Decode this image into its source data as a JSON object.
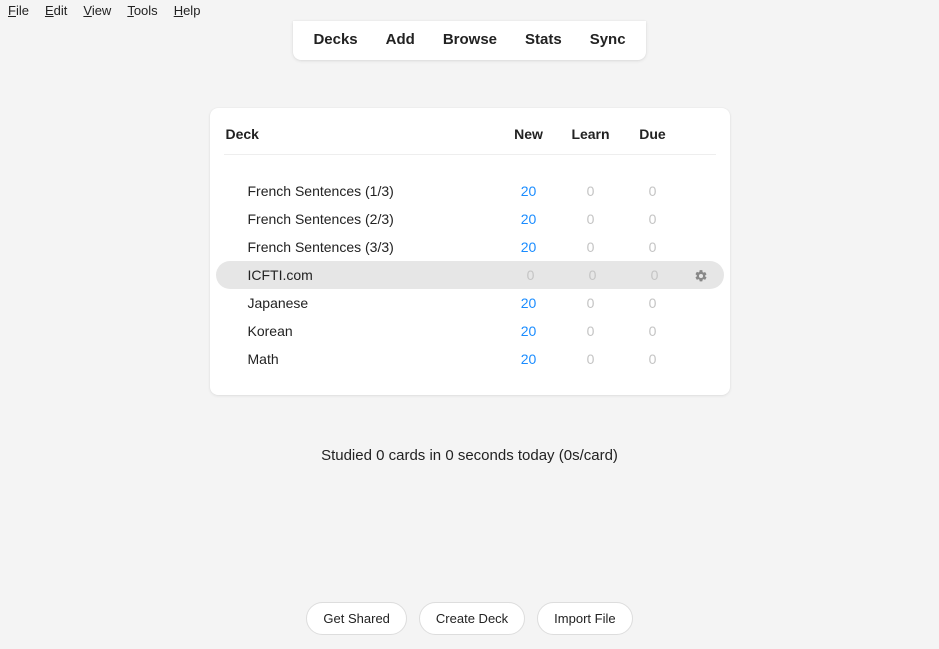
{
  "menubar": {
    "file": "File",
    "edit": "Edit",
    "view": "View",
    "tools": "Tools",
    "help": "Help"
  },
  "tabs": {
    "decks": "Decks",
    "add": "Add",
    "browse": "Browse",
    "stats": "Stats",
    "sync": "Sync"
  },
  "headers": {
    "deck": "Deck",
    "new": "New",
    "learn": "Learn",
    "due": "Due"
  },
  "decks": [
    {
      "name": "French Sentences (1/3)",
      "new": "20",
      "learn": "0",
      "due": "0",
      "hovered": false,
      "zero_new": false
    },
    {
      "name": "French Sentences (2/3)",
      "new": "20",
      "learn": "0",
      "due": "0",
      "hovered": false,
      "zero_new": false
    },
    {
      "name": "French Sentences (3/3)",
      "new": "20",
      "learn": "0",
      "due": "0",
      "hovered": false,
      "zero_new": false
    },
    {
      "name": "ICFTI.com",
      "new": "0",
      "learn": "0",
      "due": "0",
      "hovered": true,
      "zero_new": true
    },
    {
      "name": "Japanese",
      "new": "20",
      "learn": "0",
      "due": "0",
      "hovered": false,
      "zero_new": false
    },
    {
      "name": "Korean",
      "new": "20",
      "learn": "0",
      "due": "0",
      "hovered": false,
      "zero_new": false
    },
    {
      "name": "Math",
      "new": "20",
      "learn": "0",
      "due": "0",
      "hovered": false,
      "zero_new": false
    }
  ],
  "status": "Studied 0 cards in 0 seconds today (0s/card)",
  "buttons": {
    "shared": "Get Shared",
    "create": "Create Deck",
    "import": "Import File"
  }
}
